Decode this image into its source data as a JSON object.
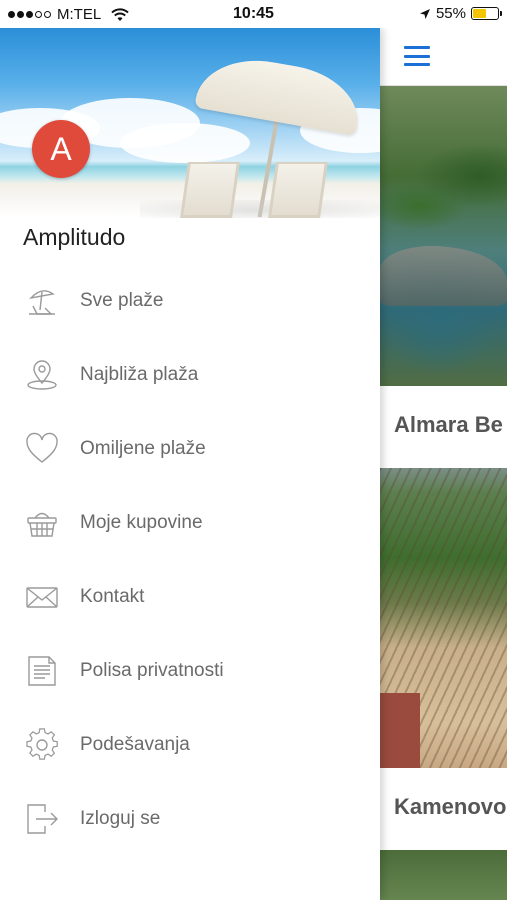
{
  "status_bar": {
    "carrier": "M:TEL",
    "time": "10:45",
    "battery": "55%",
    "battery_level": 0.55,
    "signal_bars": 3
  },
  "drawer": {
    "avatar_letter": "A",
    "username": "Amplitudo",
    "menu": [
      {
        "label": "Sve plaže",
        "icon": "beach-umbrella-icon"
      },
      {
        "label": "Najbliža plaža",
        "icon": "location-pin-icon"
      },
      {
        "label": "Omiljene plaže",
        "icon": "heart-icon"
      },
      {
        "label": "Moje kupovine",
        "icon": "basket-icon"
      },
      {
        "label": "Kontakt",
        "icon": "envelope-icon"
      },
      {
        "label": "Polisa privatnosti",
        "icon": "document-icon"
      },
      {
        "label": "Podešavanja",
        "icon": "gear-icon"
      },
      {
        "label": "Izloguj se",
        "icon": "logout-icon"
      }
    ]
  },
  "main": {
    "cards": [
      {
        "title": "Almara Be"
      },
      {
        "title": "Kamenovo"
      }
    ]
  },
  "colors": {
    "accent": "#1b6fd6",
    "avatar": "#e04a3b",
    "menu_text": "#6a6a6a"
  }
}
